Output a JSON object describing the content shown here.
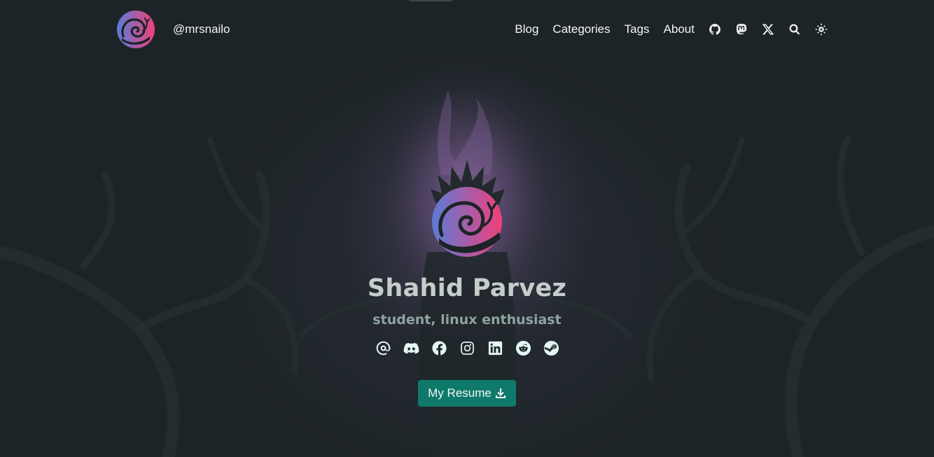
{
  "header": {
    "brand_name": "@mrsnailo",
    "nav": [
      {
        "label": "Blog"
      },
      {
        "label": "Categories"
      },
      {
        "label": "Tags"
      },
      {
        "label": "About"
      }
    ],
    "icons": [
      "github-icon",
      "mastodon-icon",
      "x-icon",
      "search-icon",
      "theme-toggle-icon"
    ]
  },
  "hero": {
    "name": "Shahid Parvez",
    "subtitle": "student, linux enthusiast",
    "socials": [
      "email-icon",
      "discord-icon",
      "facebook-icon",
      "instagram-icon",
      "linkedin-icon",
      "reddit-icon",
      "steam-icon"
    ],
    "resume_label": "My Resume"
  },
  "colors": {
    "background": "#1d2427",
    "accent_button": "#0f7a6b",
    "social_icon": "#e4f7f5",
    "logo_gradient_start": "#5b7bd6",
    "logo_gradient_end": "#f0407a"
  }
}
